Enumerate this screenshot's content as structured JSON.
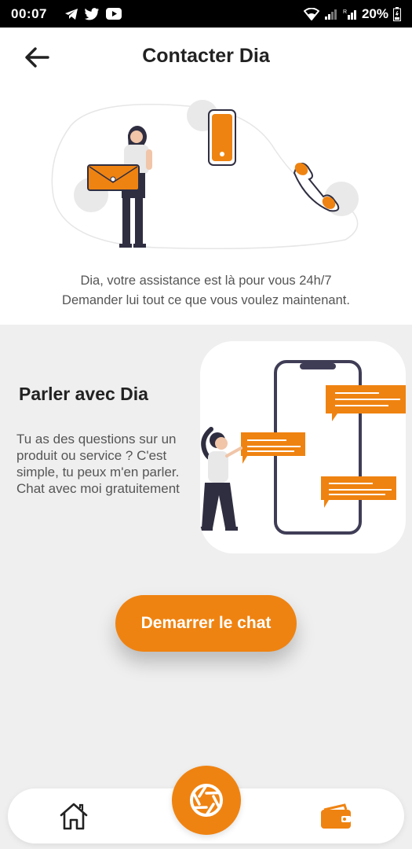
{
  "status_bar": {
    "time": "00:07",
    "battery": "20%"
  },
  "header": {
    "title": "Contacter Dia"
  },
  "hero": {
    "line1": "Dia, votre assistance est là pour vous 24h/7",
    "line2": "Demander lui tout ce que vous voulez maintenant."
  },
  "chat_card": {
    "title": "Parler avec Dia",
    "description": "Tu as des questions sur un produit ou service ? C'est simple, tu peux m'en parler. Chat avec moi gratuitement"
  },
  "cta": {
    "label": "Demarrer le chat"
  },
  "colors": {
    "accent": "#ef8311",
    "background": "#efefef"
  },
  "icons": {
    "back": "arrow-left-icon",
    "home": "home-icon",
    "center": "aperture-icon",
    "wallet": "wallet-icon"
  }
}
